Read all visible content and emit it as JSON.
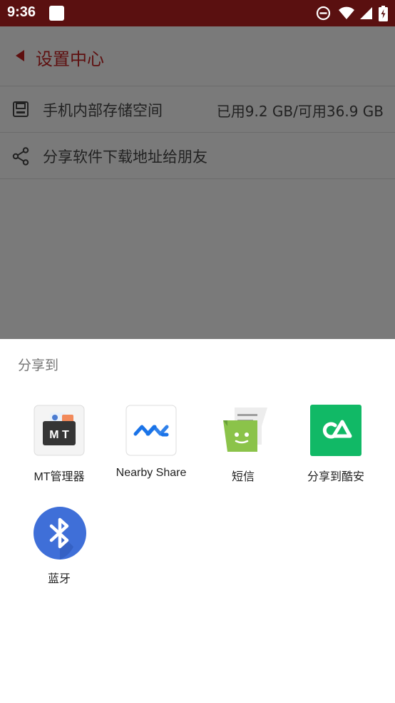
{
  "status_bar": {
    "time": "9:36",
    "icons": [
      "notification-icon",
      "do-not-disturb-icon",
      "wifi-icon",
      "signal-icon",
      "battery-charging-icon"
    ]
  },
  "app": {
    "title": "设置中心",
    "rows": [
      {
        "label": "手机内部存储空间",
        "value": "已用9.2 GB/可用36.9 GB",
        "icon": "storage-icon"
      },
      {
        "label": "分享软件下载地址给朋友",
        "value": "",
        "icon": "share-icon"
      }
    ]
  },
  "share_sheet": {
    "title": "分享到",
    "targets": [
      {
        "label": "MT管理器",
        "icon": "mt-manager-icon"
      },
      {
        "label": "Nearby Share",
        "icon": "nearby-share-icon"
      },
      {
        "label": "短信",
        "icon": "messages-icon"
      },
      {
        "label": "分享到酷安",
        "icon": "coolapk-icon"
      },
      {
        "label": "蓝牙",
        "icon": "bluetooth-icon"
      }
    ]
  },
  "colors": {
    "status_bar": "#5a1010",
    "accent": "#5e0f0f",
    "coolapk": "#11b966",
    "bluetooth": "#3f6fd8",
    "messages": "#8bc34a"
  }
}
